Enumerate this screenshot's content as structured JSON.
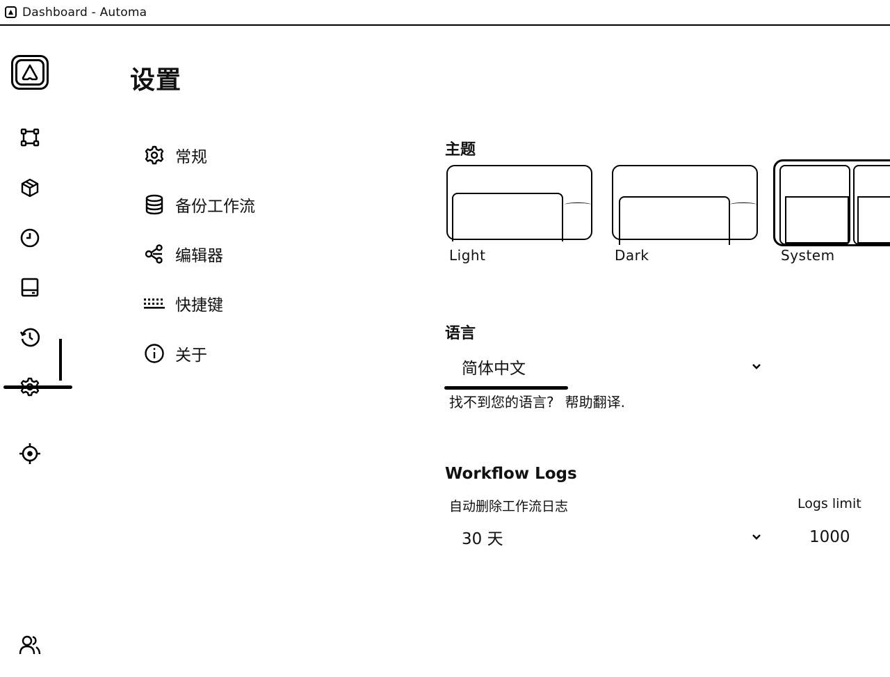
{
  "window": {
    "title": "Dashboard - Automa"
  },
  "sidebar": {
    "items": [
      {
        "name": "workflows",
        "icon": "flow-icon"
      },
      {
        "name": "packages",
        "icon": "cube-icon"
      },
      {
        "name": "schedule",
        "icon": "clock-icon"
      },
      {
        "name": "storage",
        "icon": "storage-icon"
      },
      {
        "name": "logs",
        "icon": "history-icon"
      },
      {
        "name": "settings",
        "icon": "gear-icon",
        "active": true
      },
      {
        "name": "recording",
        "icon": "crosshair-icon"
      },
      {
        "name": "team",
        "icon": "users-icon"
      }
    ]
  },
  "page": {
    "title": "设置"
  },
  "settings_menu": {
    "items": [
      {
        "label": "常规",
        "icon": "gear-icon"
      },
      {
        "label": "备份工作流",
        "icon": "database-icon"
      },
      {
        "label": "编辑器",
        "icon": "share-nodes-icon"
      },
      {
        "label": "快捷键",
        "icon": "keyboard-icon"
      },
      {
        "label": "关于",
        "icon": "info-icon"
      }
    ]
  },
  "general": {
    "theme": {
      "label": "主题",
      "options": [
        "Light",
        "Dark",
        "System"
      ],
      "selected": "System"
    },
    "language": {
      "label": "语言",
      "selected": "简体中文",
      "not_found_text": "找不到您的语言?",
      "help_link": "帮助翻译."
    },
    "workflow_logs": {
      "label": "Workflow Logs",
      "auto_delete_label": "自动删除工作流日志",
      "auto_delete_value": "30 天",
      "logs_limit_label": "Logs limit",
      "logs_limit_value": "1000"
    }
  }
}
